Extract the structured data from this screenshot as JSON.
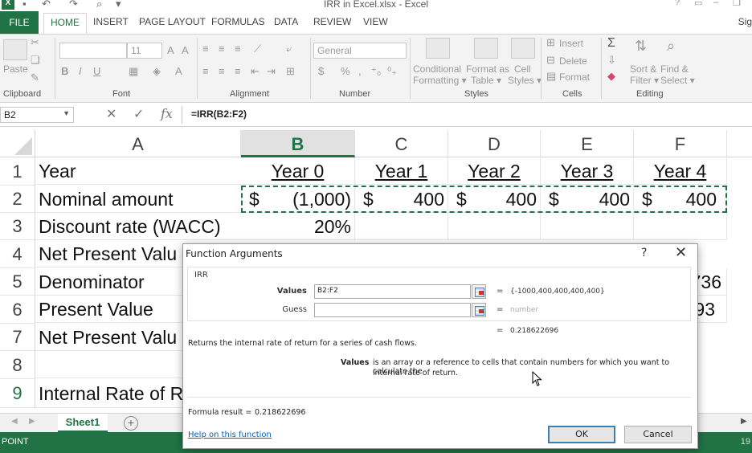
{
  "window": {
    "title": "IRR in Excel.xlsx - Excel",
    "app_logo": "X",
    "sign_in": "Sig"
  },
  "ribbon_tabs": [
    "FILE",
    "HOME",
    "INSERT",
    "PAGE LAYOUT",
    "FORMULAS",
    "DATA",
    "REVIEW",
    "VIEW"
  ],
  "ribbon": {
    "groups": {
      "clipboard": "Clipboard",
      "font": "Font",
      "alignment": "Alignment",
      "number": "Number",
      "styles": "Styles",
      "cells": "Cells",
      "editing": "Editing"
    },
    "paste": "Paste",
    "font_size": "11",
    "number_format": "General",
    "conditional_formatting": [
      "Conditional",
      "Formatting ▾"
    ],
    "format_as_table": [
      "Format as",
      "Table ▾"
    ],
    "cell_styles": [
      "Cell",
      "Styles ▾"
    ],
    "insert": "Insert",
    "delete": "Delete",
    "format": "Format",
    "sort_filter": [
      "Sort &",
      "Filter ▾"
    ],
    "find_select": [
      "Find &",
      "Select ▾"
    ]
  },
  "formula_bar": {
    "name_box": "B2",
    "formula": "=IRR(B2:F2)"
  },
  "columns": [
    "A",
    "B",
    "C",
    "D",
    "E",
    "F"
  ],
  "rows": [
    {
      "n": "1",
      "a": "Year",
      "b": "Year 0",
      "c": "Year 1",
      "d": "Year 2",
      "e": "Year 3",
      "f": "Year 4"
    },
    {
      "n": "2",
      "a": "Nominal amount",
      "b": "(1,000)",
      "c": "400",
      "d": "400",
      "e": "400",
      "f": "400",
      "currency": "$"
    },
    {
      "n": "3",
      "a": "Discount rate (WACC)",
      "b": "20%"
    },
    {
      "n": "4",
      "a": "Net Present Valu"
    },
    {
      "n": "5",
      "a": "Denominator",
      "f": "736"
    },
    {
      "n": "6",
      "a": "Present Value",
      "f": "93"
    },
    {
      "n": "7",
      "a": "Net Present Valu"
    },
    {
      "n": "8",
      "a": ""
    },
    {
      "n": "9",
      "a": "Internal Rate of R"
    }
  ],
  "sheet_tab": "Sheet1",
  "status": {
    "mode": "POINT",
    "zoom": "19"
  },
  "dialog": {
    "title": "Function Arguments",
    "help_glyph": "?",
    "close_glyph": "✕",
    "function_name": "IRR",
    "args": [
      {
        "label": "Values",
        "value": "B2:F2",
        "result": "{-1000,400,400,400,400}"
      },
      {
        "label": "Guess",
        "value": "",
        "result": "number"
      }
    ],
    "equals": "=",
    "overall_result": "0.218622696",
    "description": "Returns the internal rate of return for a series of cash flows.",
    "arg_help_name": "Values",
    "arg_help_text_1": "is an array or a reference to cells that contain numbers for which you want to calculate the",
    "arg_help_text_2": "internal rate of return.",
    "formula_result_label": "Formula result =",
    "formula_result_value": "0.218622696",
    "help_link": "Help on this function",
    "ok": "OK",
    "cancel": "Cancel"
  }
}
